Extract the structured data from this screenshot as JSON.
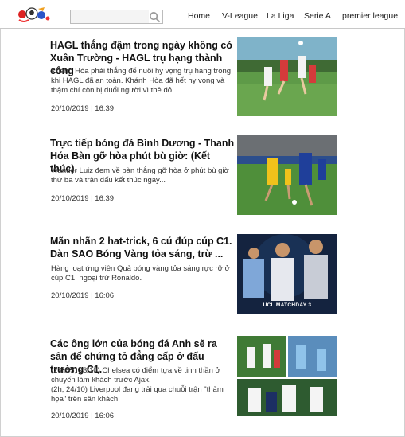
{
  "header": {
    "logo_icon": "soccer-logo-icon",
    "search": {
      "placeholder": "",
      "value": "",
      "icon": "search-icon"
    },
    "nav": [
      "Home",
      "V-League",
      "La Liga",
      "Serie A",
      "premier league"
    ]
  },
  "articles": [
    {
      "title": "HAGL thắng đậm trong ngày không có Xuân Trường - HAGL trụ hạng thành công",
      "desc": "Khánh Hòa phải thắng để nuôi hy vọng trụ hạng trong khi HAGL đã an toàn. Khánh Hòa đã hết hy vọng và thậm chí còn bị đuổi người vì thẻ đỏ.",
      "date": "20/10/2019 | 16:39",
      "thumb_label": ""
    },
    {
      "title": "Trực tiếp bóng đá Bình Dương - Thanh Hóa Bàn gỡ hòa phút bù giờ: (Kết thúc).",
      "desc": "Wander Luiz đem về bàn thắng gỡ hòa ở phút bù giờ thứ ba và trận đấu kết thúc ngay...",
      "date": "20/10/2019 | 16:39",
      "thumb_label": ""
    },
    {
      "title": "Mãn nhãn 2 hat-trick, 6 cú đúp cúp C1. Dàn SAO Bóng Vàng tỏa sáng, trừ ...",
      "desc": "Hàng loạt ứng viên Quả bóng vàng tỏa sáng rực rỡ ở cúp C1, ngoại trừ Ronaldo.",
      "date": "20/10/2019 | 16:06",
      "thumb_label": "UCL MATCHDAY 3"
    },
    {
      "title": "Các ông lớn của bóng đá Anh sẽ ra sân để chứng tỏ đẳng cấp ở đấu trường C1.",
      "desc": "(23h55, 23/10) Chelsea có điểm tựa về tinh thần ở chuyến làm khách trước Ajax.\n(2h, 24/10) Liverpool đang trải qua chuỗi trận \"thảm họa\" trên sân khách.",
      "date": "20/10/2019 | 16:06",
      "thumb_label": ""
    }
  ],
  "colors": {
    "pitch": "#4f8f3a",
    "ucl_bg": "#14233f",
    "text": "#222222"
  }
}
